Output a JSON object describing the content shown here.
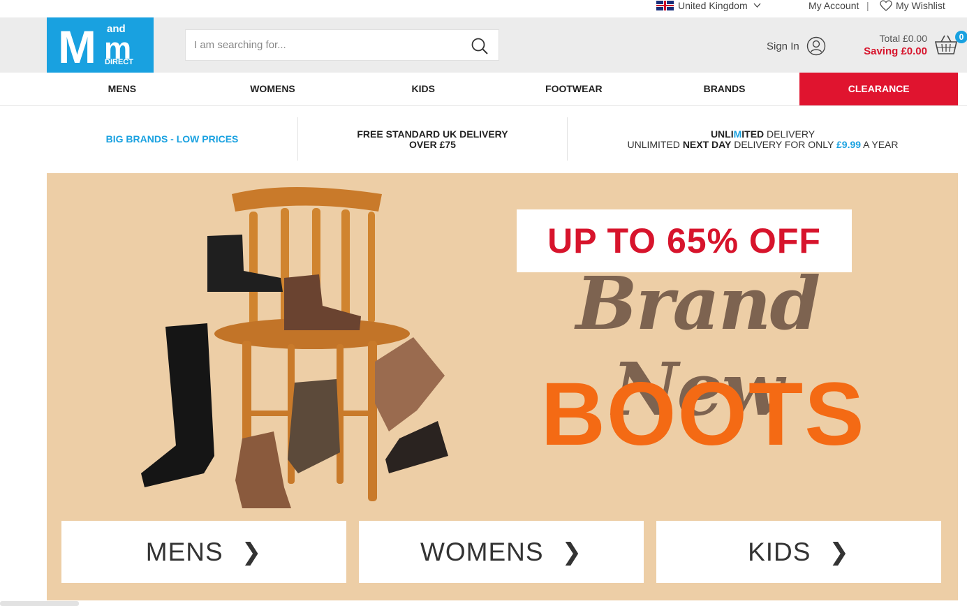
{
  "utility": {
    "country": "United Kingdom",
    "account": "My Account",
    "separator": "|",
    "wishlist": "My Wishlist"
  },
  "header": {
    "logo": {
      "big": "M",
      "small": "m",
      "and": "and",
      "direct": "DIRECT"
    },
    "search_placeholder": "I am searching for...",
    "signin": "Sign In",
    "total": "Total £0.00",
    "saving": "Saving £0.00",
    "basket_count": "0"
  },
  "nav": {
    "items": [
      "MENS",
      "WOMENS",
      "KIDS",
      "FOOTWEAR",
      "BRANDS",
      "CLEARANCE"
    ]
  },
  "usp": {
    "brands": "BIG BRANDS - LOW PRICES",
    "delivery_line1": "FREE STANDARD UK DELIVERY",
    "delivery_line2": "OVER £75",
    "unlimited_a": "UNLI",
    "unlimited_b": "M",
    "unlimited_c": "ITED",
    "unlimited_d": " DELIVERY",
    "line2_a": "UNLIMITED ",
    "line2_b": "NEXT DAY",
    "line2_c": " DELIVERY FOR ONLY ",
    "line2_price": "£9.99",
    "line2_d": " A YEAR"
  },
  "banner": {
    "promo": "UP TO 65% OFF",
    "script": "Brand New",
    "headline": "BOOTS",
    "categories": [
      "MENS",
      "WOMENS",
      "KIDS"
    ],
    "arrow": "❯"
  },
  "colors": {
    "brand_blue": "#19a1e0",
    "clearance_red": "#e0142f",
    "banner_bg": "#edcea6",
    "boots_orange": "#f46a14"
  }
}
